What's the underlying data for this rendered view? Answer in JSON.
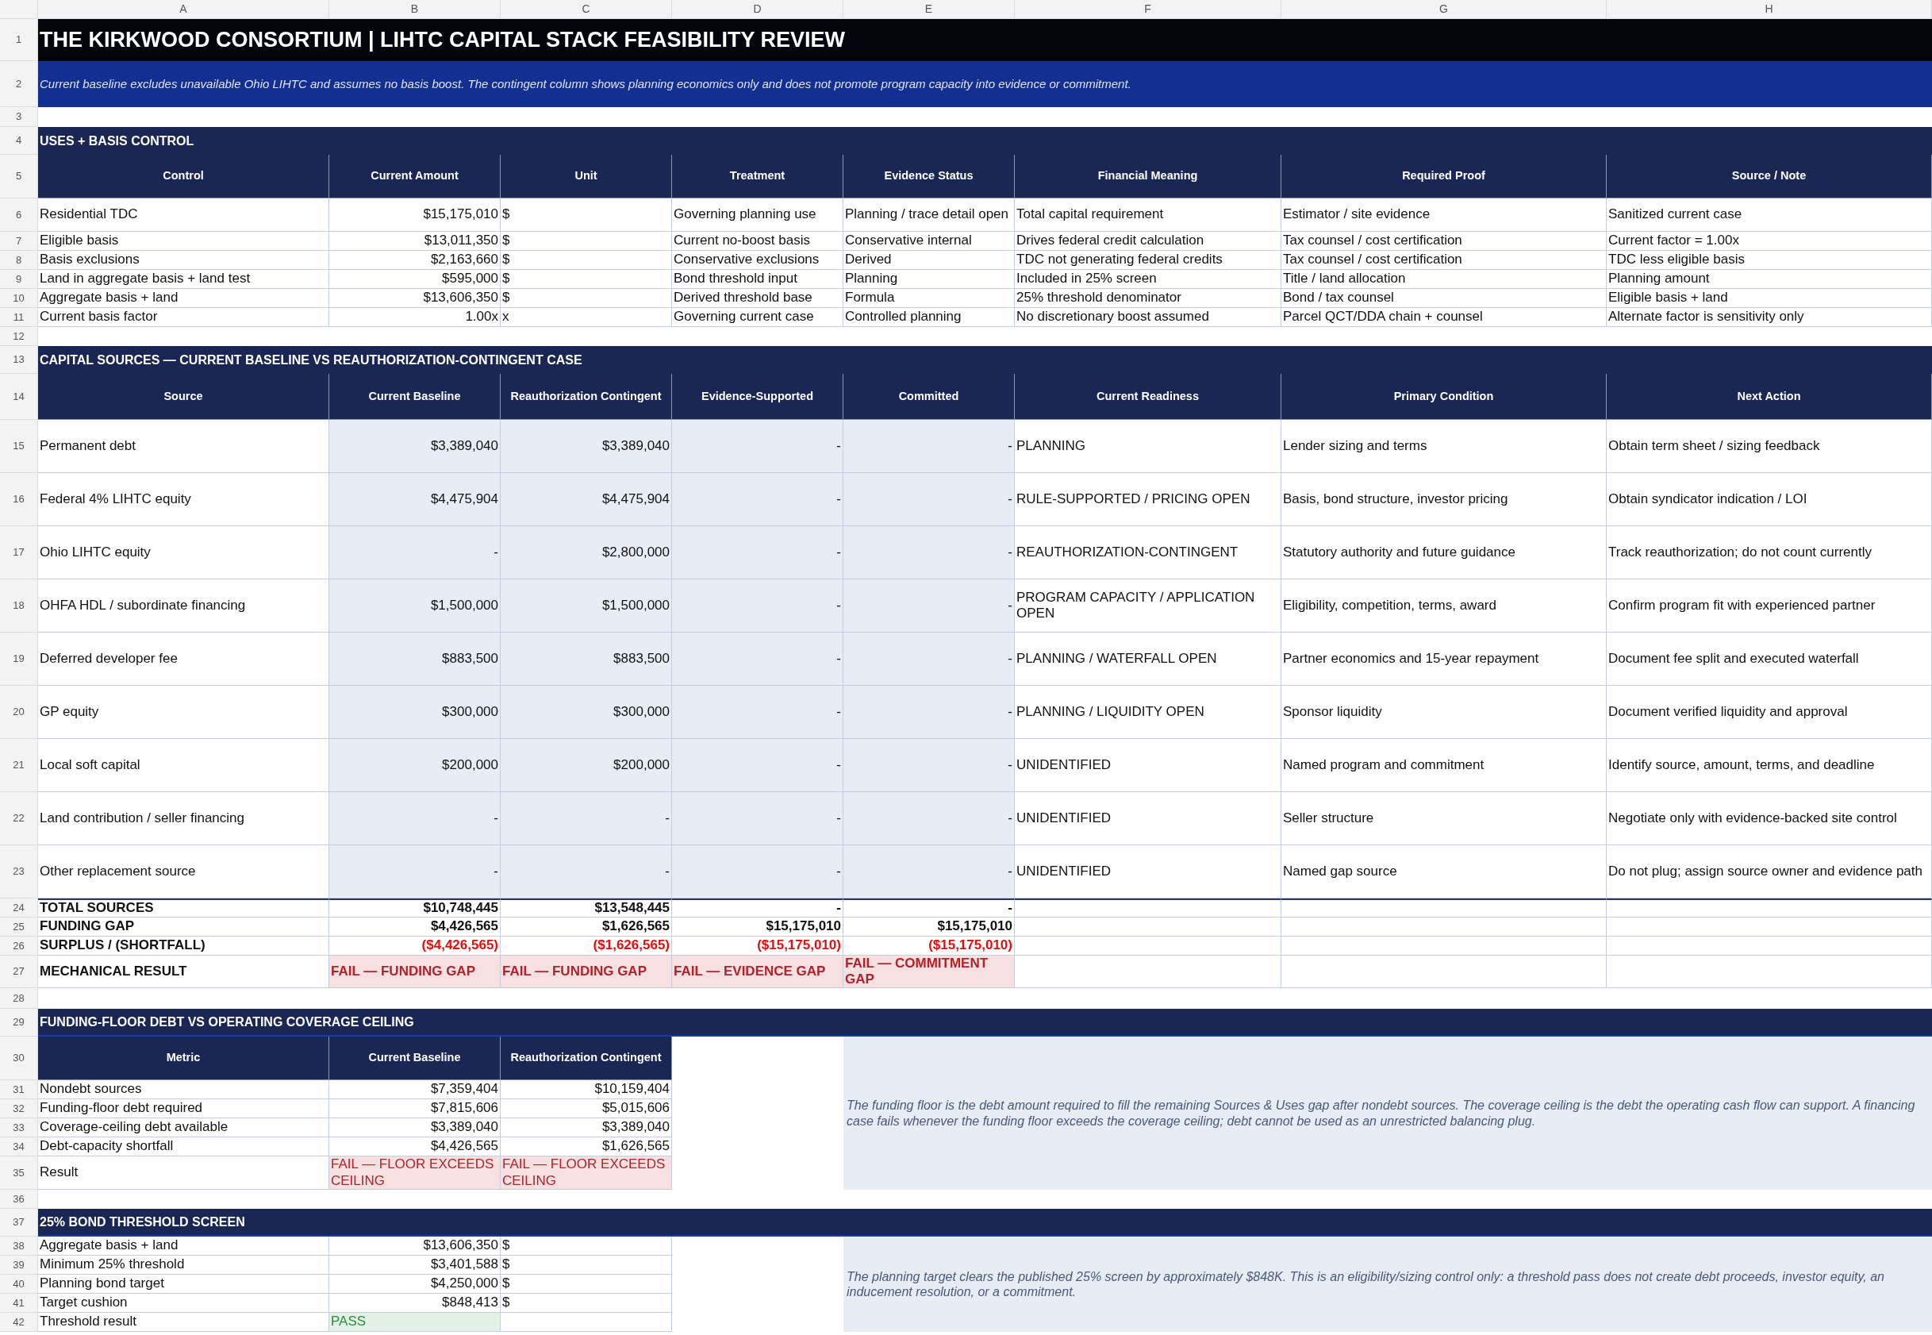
{
  "column_letters": [
    "A",
    "B",
    "C",
    "D",
    "E",
    "F",
    "G",
    "H"
  ],
  "row_numbers": [
    "1",
    "2",
    "3",
    "4",
    "5",
    "6",
    "7",
    "8",
    "9",
    "10",
    "11",
    "12",
    "13",
    "14",
    "15",
    "16",
    "17",
    "18",
    "19",
    "20",
    "21",
    "22",
    "23",
    "24",
    "25",
    "26",
    "27",
    "28",
    "29",
    "30",
    "31",
    "32",
    "33",
    "34",
    "35",
    "36",
    "37",
    "38",
    "39",
    "40",
    "41",
    "42"
  ],
  "title": "THE KIRKWOOD CONSORTIUM | LIHTC CAPITAL STACK FEASIBILITY REVIEW",
  "subtitle": "Current baseline excludes unavailable Ohio LIHTC and assumes no basis boost. The contingent column shows planning economics only and does not promote program capacity into evidence or commitment.",
  "uses_basis": {
    "title": "USES + BASIS CONTROL",
    "columns": [
      "Control",
      "Current Amount",
      "Unit",
      "Treatment",
      "Evidence Status",
      "Financial Meaning",
      "Required Proof",
      "Source / Note"
    ],
    "rows": [
      [
        "Residential TDC",
        "$15,175,010",
        "$",
        "Governing planning use",
        "Planning / trace detail open",
        "Total capital requirement",
        "Estimator / site evidence",
        "Sanitized current case"
      ],
      [
        "Eligible basis",
        "$13,011,350",
        "$",
        "Current no-boost basis",
        "Conservative internal",
        "Drives federal credit calculation",
        "Tax counsel / cost certification",
        "Current factor = 1.00x"
      ],
      [
        "Basis exclusions",
        "$2,163,660",
        "$",
        "Conservative exclusions",
        "Derived",
        "TDC not generating federal credits",
        "Tax counsel / cost certification",
        "TDC less eligible basis"
      ],
      [
        "Land in aggregate basis + land test",
        "$595,000",
        "$",
        "Bond threshold input",
        "Planning",
        "Included in 25% screen",
        "Title / land allocation",
        "Planning amount"
      ],
      [
        "Aggregate basis + land",
        "$13,606,350",
        "$",
        "Derived threshold base",
        "Formula",
        "25% threshold denominator",
        "Bond / tax counsel",
        "Eligible basis + land"
      ],
      [
        "Current basis factor",
        "1.00x",
        "x",
        "Governing current case",
        "Controlled planning",
        "No discretionary boost assumed",
        "Parcel QCT/DDA chain + counsel",
        "Alternate factor is sensitivity only"
      ]
    ]
  },
  "capital_sources": {
    "title": "CAPITAL SOURCES — CURRENT BASELINE VS REAUTHORIZATION-CONTINGENT CASE",
    "columns": [
      "Source",
      "Current Baseline",
      "Reauthorization Contingent",
      "Evidence-Supported",
      "Committed",
      "Current Readiness",
      "Primary Condition",
      "Next Action"
    ],
    "rows": [
      [
        "Permanent debt",
        "$3,389,040",
        "$3,389,040",
        "-",
        "-",
        "PLANNING",
        "Lender sizing and terms",
        "Obtain term sheet / sizing feedback"
      ],
      [
        "Federal 4% LIHTC equity",
        "$4,475,904",
        "$4,475,904",
        "-",
        "-",
        "RULE-SUPPORTED / PRICING OPEN",
        "Basis, bond structure, investor pricing",
        "Obtain syndicator indication / LOI"
      ],
      [
        "Ohio LIHTC equity",
        "-",
        "$2,800,000",
        "-",
        "-",
        "REAUTHORIZATION-CONTINGENT",
        "Statutory authority and future guidance",
        "Track reauthorization; do not count currently"
      ],
      [
        "OHFA HDL / subordinate financing",
        "$1,500,000",
        "$1,500,000",
        "-",
        "-",
        "PROGRAM CAPACITY / APPLICATION OPEN",
        "Eligibility, competition, terms, award",
        "Confirm program fit with experienced partner"
      ],
      [
        "Deferred developer fee",
        "$883,500",
        "$883,500",
        "-",
        "-",
        "PLANNING / WATERFALL OPEN",
        "Partner economics and 15-year repayment",
        "Document fee split and executed waterfall"
      ],
      [
        "GP equity",
        "$300,000",
        "$300,000",
        "-",
        "-",
        "PLANNING / LIQUIDITY OPEN",
        "Sponsor liquidity",
        "Document verified liquidity and approval"
      ],
      [
        "Local soft capital",
        "$200,000",
        "$200,000",
        "-",
        "-",
        "UNIDENTIFIED",
        "Named program and commitment",
        "Identify source, amount, terms, and deadline"
      ],
      [
        "Land contribution / seller financing",
        "-",
        "-",
        "-",
        "-",
        "UNIDENTIFIED",
        "Seller structure",
        "Negotiate only with evidence-backed site control"
      ],
      [
        "Other replacement source",
        "-",
        "-",
        "-",
        "-",
        "UNIDENTIFIED",
        "Named gap source",
        "Do not plug; assign source owner and evidence path"
      ]
    ],
    "totals": [
      {
        "kind": "total",
        "label": "TOTAL SOURCES",
        "values": [
          {
            "text": "$10,748,445"
          },
          {
            "text": "$13,548,445"
          },
          {
            "text": "-"
          },
          {
            "text": "-"
          }
        ]
      },
      {
        "kind": "total",
        "label": "FUNDING GAP",
        "values": [
          {
            "text": "$4,426,565"
          },
          {
            "text": "$1,626,565"
          },
          {
            "text": "$15,175,010"
          },
          {
            "text": "$15,175,010"
          }
        ]
      },
      {
        "kind": "shortfall",
        "label": "SURPLUS / (SHORTFALL)",
        "values": [
          {
            "text": "($4,426,565)"
          },
          {
            "text": "($1,626,565)"
          },
          {
            "text": "($15,175,010)"
          },
          {
            "text": "($15,175,010)"
          }
        ]
      },
      {
        "kind": "result",
        "label": "MECHANICAL RESULT",
        "values": [
          {
            "text": "FAIL — FUNDING GAP",
            "passed": false
          },
          {
            "text": "FAIL — FUNDING GAP",
            "passed": false
          },
          {
            "text": "FAIL — EVIDENCE GAP",
            "passed": false
          },
          {
            "text": "FAIL — COMMITMENT GAP",
            "passed": false
          }
        ]
      }
    ]
  },
  "funding_floor": {
    "title": "FUNDING-FLOOR DEBT VS OPERATING COVERAGE CEILING",
    "columns": [
      "Metric",
      "Current Baseline",
      "Reauthorization Contingent"
    ],
    "rows": [
      {
        "label": "Nondebt sources",
        "values": [
          {
            "text": "$7,359,404"
          },
          {
            "text": "$10,159,404"
          }
        ]
      },
      {
        "label": "Funding-floor debt required",
        "values": [
          {
            "text": "$7,815,606"
          },
          {
            "text": "$5,015,606"
          }
        ]
      },
      {
        "label": "Coverage-ceiling debt available",
        "values": [
          {
            "text": "$3,389,040"
          },
          {
            "text": "$3,389,040"
          }
        ]
      },
      {
        "label": "Debt-capacity shortfall",
        "values": [
          {
            "text": "$4,426,565"
          },
          {
            "text": "$1,626,565"
          }
        ]
      },
      {
        "label": "Result",
        "values": [
          {
            "text": "FAIL — FLOOR EXCEEDS CEILING",
            "passed": false
          },
          {
            "text": "FAIL — FLOOR EXCEEDS CEILING",
            "passed": false
          }
        ]
      }
    ],
    "note": "The funding floor is the debt amount required to fill the remaining Sources & Uses gap after nondebt sources. The coverage ceiling is the debt the operating cash flow can support. A financing case fails whenever the funding floor exceeds the coverage ceiling; debt cannot be used as an unrestricted balancing plug."
  },
  "bond_threshold": {
    "title": "25% BOND THRESHOLD SCREEN",
    "rows": [
      {
        "label": "Aggregate basis + land",
        "value": "$13,606,350",
        "unit": "$"
      },
      {
        "label": "Minimum 25% threshold",
        "value": "$3,401,588",
        "unit": "$"
      },
      {
        "label": "Planning bond target",
        "value": "$4,250,000",
        "unit": "$"
      },
      {
        "label": "Target cushion",
        "value": "$848,413",
        "unit": "$"
      },
      {
        "label": "Threshold result",
        "value": "PASS",
        "passed": true
      }
    ],
    "note": "The planning target clears the published 25% screen by approximately $848K. This is an eligibility/sizing control only: a threshold pass does not create debt proceeds, investor equity, an inducement resolution, or a commitment."
  }
}
